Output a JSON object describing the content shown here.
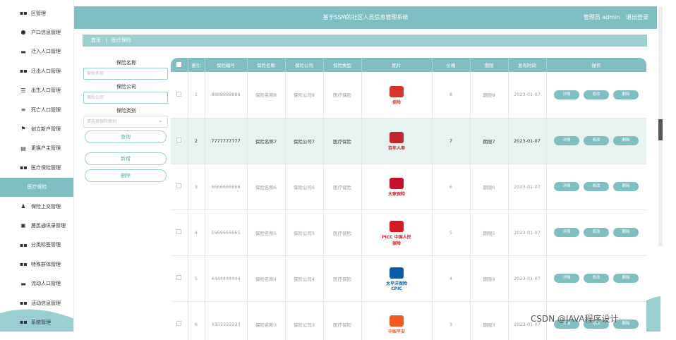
{
  "app_title": "基于SSM的社区人员信息管理系统",
  "user": {
    "role": "管理员 admin",
    "logout": "退出登录"
  },
  "breadcrumb": {
    "home": "首页",
    "sep": "|",
    "current": "医疗保险"
  },
  "sidebar": {
    "items": [
      {
        "label": "区管理",
        "icon": "grid-icon"
      },
      {
        "label": "户口信息管理",
        "icon": "pin-icon"
      },
      {
        "label": "迁入人口管理",
        "icon": "doc-icon"
      },
      {
        "label": "迁出人口管理",
        "icon": "grid-icon"
      },
      {
        "label": "出生人口管理",
        "icon": "menu-icon"
      },
      {
        "label": "死亡人口管理",
        "icon": "list-icon"
      },
      {
        "label": "创立新户管理",
        "icon": "flag-icon"
      },
      {
        "label": "更换户主管理",
        "icon": "card-icon"
      },
      {
        "label": "医疗保险管理",
        "icon": "grid-icon"
      },
      {
        "label": "医疗保险",
        "icon": "",
        "active": true
      },
      {
        "label": "保险上交管理",
        "icon": "user-icon"
      },
      {
        "label": "居民通讯录管理",
        "icon": "book-icon"
      },
      {
        "label": "分类标签管理",
        "icon": "grid-icon"
      },
      {
        "label": "特殊群体管理",
        "icon": "grid-icon"
      },
      {
        "label": "流动人口管理",
        "icon": "chat-icon"
      },
      {
        "label": "活动信息管理",
        "icon": "grid-icon"
      },
      {
        "label": "系统管理",
        "icon": "grid-icon"
      }
    ]
  },
  "search": {
    "name_label": "保险名称",
    "name_placeholder": "保险名称",
    "company_label": "保险公司",
    "company_placeholder": "保险公司",
    "type_label": "保险类别",
    "type_placeholder": "请选择保险类别",
    "query": "查询",
    "add": "新增",
    "delete": "删除"
  },
  "table": {
    "headers": [
      "索引",
      "保险编号",
      "保险名称",
      "保险公司",
      "保险类型",
      "图片",
      "价格",
      "期限",
      "发布时间",
      "操作"
    ],
    "actions": {
      "detail": "详情",
      "edit": "修改",
      "del": "删除"
    },
    "rows": [
      {
        "idx": "1",
        "code": "8888888888",
        "name": "保险名称8",
        "company": "保险公司8",
        "type": "医疗保险",
        "price": "8",
        "term": "期限8",
        "date": "2023-01-07",
        "logo": "保险",
        "logo_color": "#d6342a"
      },
      {
        "idx": "2",
        "code": "7777777777",
        "name": "保险名称7",
        "company": "保险公司7",
        "type": "医疗保险",
        "price": "7",
        "term": "期限7",
        "date": "2023-01-07",
        "logo": "百年人寿",
        "logo_color": "#c0272d"
      },
      {
        "idx": "3",
        "code": "6666666666",
        "name": "保险名称6",
        "company": "保险公司6",
        "type": "医疗保险",
        "price": "6",
        "term": "期限6",
        "date": "2023-01-07",
        "logo": "大家保险",
        "logo_color": "#c8102e"
      },
      {
        "idx": "4",
        "code": "5555555555",
        "name": "保险名称5",
        "company": "保险公司5",
        "type": "医疗保险",
        "price": "5",
        "term": "期限5",
        "date": "2023-01-07",
        "logo": "PICC 中国人民保险",
        "logo_color": "#d71920"
      },
      {
        "idx": "5",
        "code": "4444444444",
        "name": "保险名称4",
        "company": "保险公司4",
        "type": "医疗保险",
        "price": "4",
        "term": "期限4",
        "date": "2023-01-07",
        "logo": "太平洋保险 CPIC",
        "logo_color": "#0a5ca8"
      },
      {
        "idx": "6",
        "code": "3333333333",
        "name": "保险名称3",
        "company": "保险公司3",
        "type": "医疗保险",
        "price": "3",
        "term": "期限3",
        "date": "2023-01-07",
        "logo": "中国平安",
        "logo_color": "#f05a23"
      }
    ]
  },
  "watermark": "CSDN @JAVA程序设计",
  "colors": {
    "accent": "#7fbfc2",
    "highlight_row": "#e6f3f1"
  }
}
